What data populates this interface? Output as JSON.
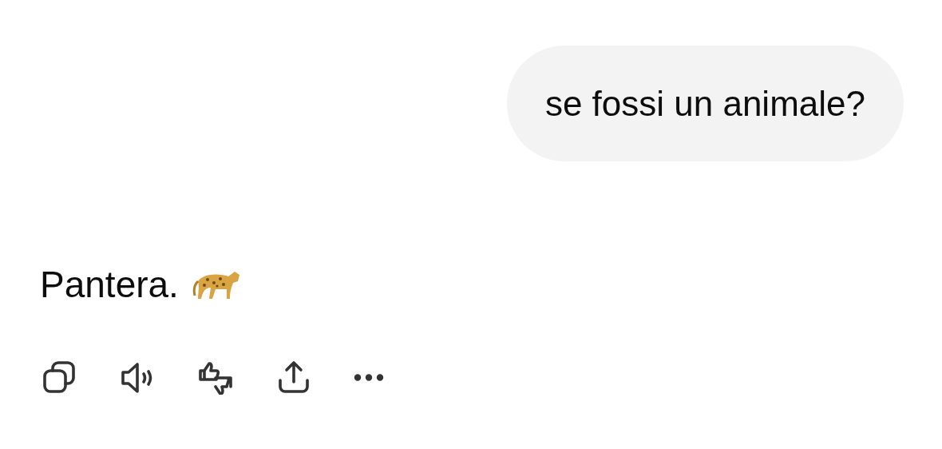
{
  "user_message": {
    "text": "se fossi un animale?"
  },
  "reply": {
    "text": "Pantera."
  },
  "actions": [
    {
      "kind": "copy"
    },
    {
      "kind": "speak"
    },
    {
      "kind": "feedback"
    },
    {
      "kind": "share"
    },
    {
      "kind": "more"
    }
  ]
}
